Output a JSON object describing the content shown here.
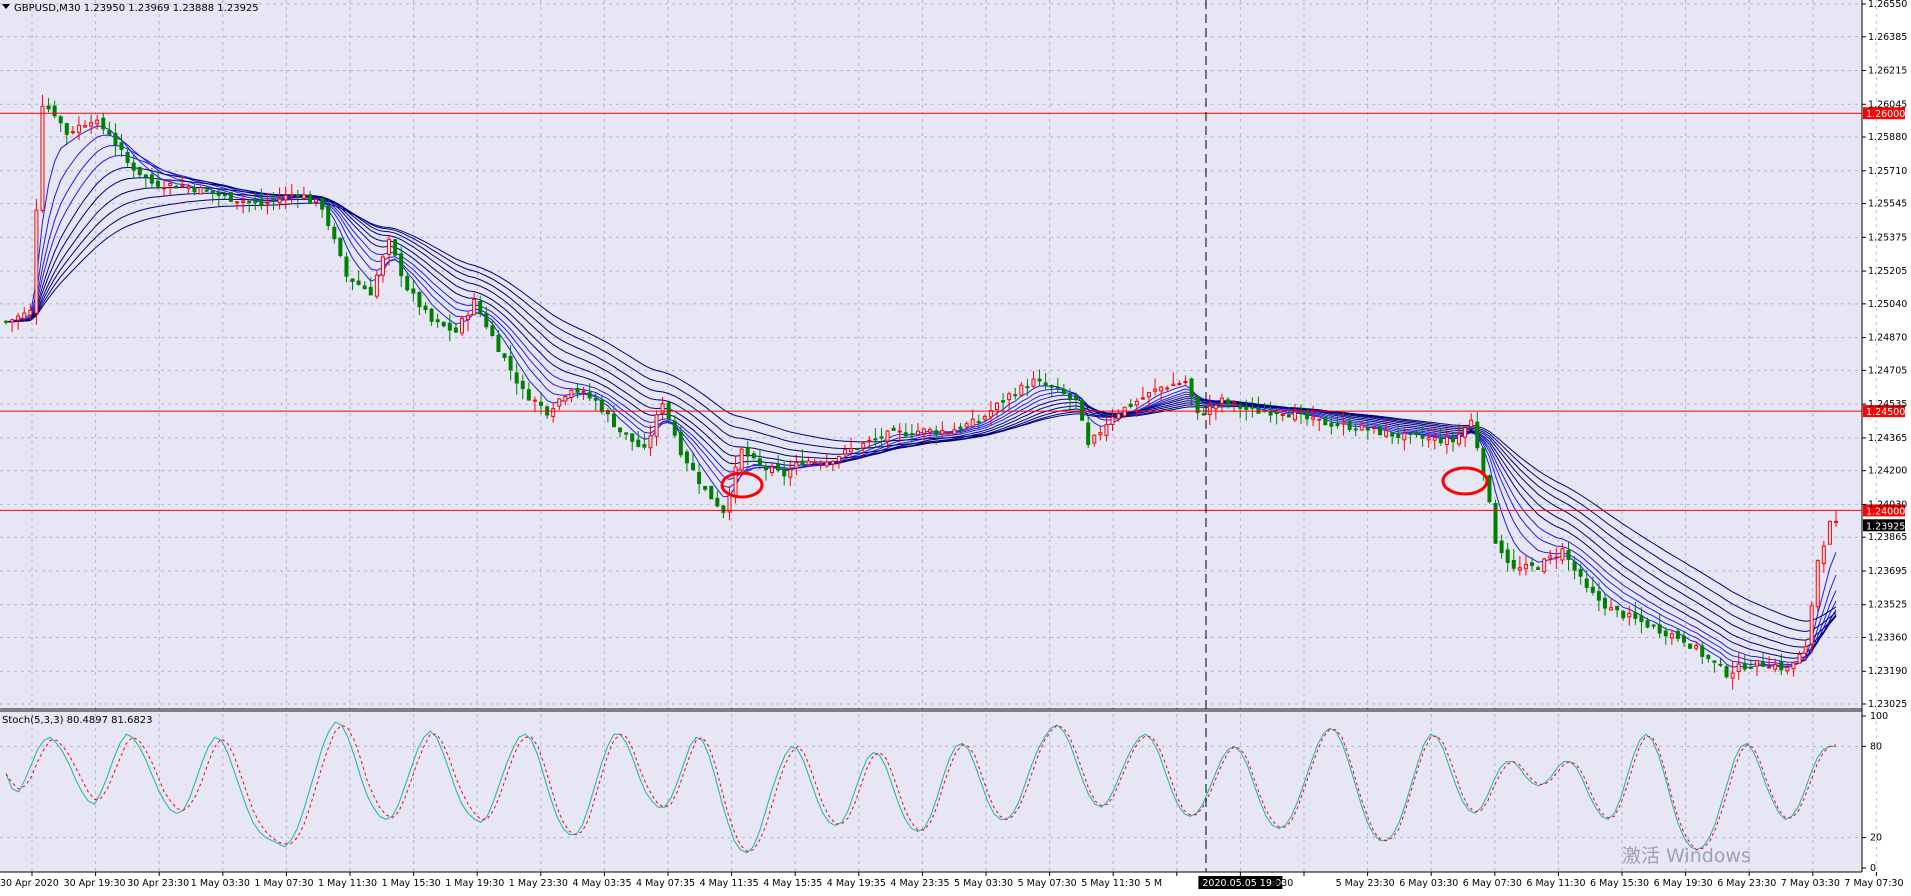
{
  "window": {
    "symbol_header": "GBPUSD,M30  1.23950 1.23969 1.23888 1.23925",
    "stoch_header": "Stoch(5,3,3) 80.4897 81.6823",
    "watermark": "激活 Windows"
  },
  "colors": {
    "background": "#e6e6f5",
    "grid": "#9a9ab4",
    "bull_candle": "#ff0000",
    "bear_candle": "#008000",
    "ma_ribbon": "#000080",
    "horizontal_lines": "#ff0000",
    "stoch_main": "#20b2aa",
    "stoch_signal": "#ff0000"
  },
  "chart_data": [
    {
      "type": "candlestick",
      "title": "GBPUSD,M30",
      "ylim": [
        1.23025,
        1.2655
      ],
      "y_ticks": [
        "1.26550",
        "1.26385",
        "1.26215",
        "1.26045",
        "1.25880",
        "1.25710",
        "1.25545",
        "1.25375",
        "1.25205",
        "1.25040",
        "1.24870",
        "1.24705",
        "1.24535",
        "1.24365",
        "1.24200",
        "1.24030",
        "1.23865",
        "1.23695",
        "1.23525",
        "1.23360",
        "1.23190",
        "1.23025"
      ],
      "x_ticks": [
        "30 Apr 2020",
        "30 Apr 19:30",
        "30 Apr 23:30",
        "1 May 03:30",
        "1 May 07:30",
        "1 May 11:30",
        "1 May 15:30",
        "1 May 19:30",
        "1 May 23:30",
        "4 May 03:35",
        "4 May 07:35",
        "4 May 11:35",
        "4 May 15:35",
        "4 May 19:35",
        "4 May 23:35",
        "5 May 03:30",
        "5 May 07:30",
        "5 May 11:30",
        "5 M",
        "2020.05.05 19:00",
        "9:30",
        "5 May 23:30",
        "6 May 03:30",
        "6 May 07:30",
        "6 May 11:30",
        "6 May 15:30",
        "6 May 19:30",
        "6 May 23:30",
        "7 May 03:30",
        "7 May 07:30"
      ],
      "price_levels": [
        {
          "label": "1.26000",
          "value": 1.26
        },
        {
          "label": "1.24500",
          "value": 1.245
        },
        {
          "label": "1.24000",
          "value": 1.24
        }
      ],
      "current_price": {
        "label": "1.23925",
        "value": 1.23925
      },
      "path_anchors": [
        [
          0,
          1.2495
        ],
        [
          4,
          1.25
        ],
        [
          6,
          1.2605
        ],
        [
          8,
          1.26
        ],
        [
          10,
          1.259
        ],
        [
          14,
          1.2597
        ],
        [
          17,
          1.259
        ],
        [
          20,
          1.2575
        ],
        [
          24,
          1.2565
        ],
        [
          30,
          1.2563
        ],
        [
          36,
          1.2558
        ],
        [
          42,
          1.2554
        ],
        [
          48,
          1.256
        ],
        [
          52,
          1.2553
        ],
        [
          56,
          1.2518
        ],
        [
          60,
          1.251
        ],
        [
          63,
          1.2535
        ],
        [
          66,
          1.2512
        ],
        [
          70,
          1.2495
        ],
        [
          74,
          1.249
        ],
        [
          77,
          1.2505
        ],
        [
          81,
          1.2482
        ],
        [
          85,
          1.246
        ],
        [
          89,
          1.245
        ],
        [
          93,
          1.2462
        ],
        [
          97,
          1.2455
        ],
        [
          101,
          1.244
        ],
        [
          105,
          1.243
        ],
        [
          108,
          1.2455
        ],
        [
          111,
          1.243
        ],
        [
          115,
          1.241
        ],
        [
          118,
          1.24
        ],
        [
          121,
          1.243
        ],
        [
          124,
          1.2422
        ],
        [
          128,
          1.2418
        ],
        [
          131,
          1.2425
        ],
        [
          135,
          1.2425
        ],
        [
          140,
          1.2432
        ],
        [
          145,
          1.2438
        ],
        [
          150,
          1.244
        ],
        [
          155,
          1.244
        ],
        [
          160,
          1.2445
        ],
        [
          165,
          1.2458
        ],
        [
          169,
          1.2465
        ],
        [
          173,
          1.246
        ],
        [
          176,
          1.2455
        ],
        [
          178,
          1.2432
        ],
        [
          182,
          1.2448
        ],
        [
          186,
          1.2455
        ],
        [
          190,
          1.2462
        ],
        [
          194,
          1.2465
        ],
        [
          196,
          1.2448
        ],
        [
          200,
          1.2455
        ],
        [
          205,
          1.245
        ],
        [
          210,
          1.245
        ],
        [
          215,
          1.2445
        ],
        [
          222,
          1.2442
        ],
        [
          230,
          1.2437
        ],
        [
          238,
          1.2435
        ],
        [
          241,
          1.2445
        ],
        [
          243,
          1.242
        ],
        [
          245,
          1.2385
        ],
        [
          248,
          1.237
        ],
        [
          252,
          1.2372
        ],
        [
          256,
          1.238
        ],
        [
          260,
          1.236
        ],
        [
          264,
          1.235
        ],
        [
          268,
          1.2345
        ],
        [
          272,
          1.234
        ],
        [
          276,
          1.2335
        ],
        [
          280,
          1.2325
        ],
        [
          283,
          1.2318
        ],
        [
          286,
          1.2322
        ],
        [
          290,
          1.2323
        ],
        [
          293,
          1.232
        ],
        [
          296,
          1.233
        ],
        [
          298,
          1.2375
        ],
        [
          300,
          1.2393
        ],
        [
          301,
          1.23925
        ]
      ],
      "stochastic": {
        "type": "line",
        "ylim": [
          0,
          100
        ],
        "y_ticks": [
          "100",
          "80",
          "20",
          "0"
        ],
        "levels": [
          80,
          20
        ],
        "series": [
          {
            "name": "main",
            "values": [
              62,
              52,
              50,
              58,
              68,
              78,
              84,
              86,
              82,
              76,
              68,
              58,
              50,
              44,
              42,
              50,
              60,
              72,
              82,
              88,
              86,
              80,
              72,
              62,
              52,
              44,
              38,
              36,
              38,
              46,
              58,
              70,
              80,
              86,
              84,
              76,
              64,
              52,
              40,
              30,
              24,
              20,
              18,
              16,
              14,
              18,
              26,
              38,
              52,
              66,
              80,
              90,
              96,
              94,
              86,
              74,
              60,
              48,
              40,
              34,
              32,
              34,
              42,
              54,
              66,
              78,
              86,
              90,
              86,
              76,
              64,
              52,
              42,
              36,
              32,
              30,
              34,
              44,
              56,
              68,
              78,
              86,
              88,
              84,
              74,
              60,
              46,
              34,
              26,
              22,
              22,
              28,
              40,
              54,
              68,
              80,
              88,
              88,
              82,
              72,
              60,
              50,
              44,
              40,
              40,
              46,
              56,
              68,
              80,
              86,
              84,
              74,
              60,
              44,
              30,
              18,
              12,
              10,
              14,
              24,
              38,
              52,
              64,
              74,
              80,
              78,
              70,
              58,
              46,
              36,
              30,
              28,
              30,
              38,
              50,
              62,
              72,
              76,
              74,
              66,
              54,
              42,
              32,
              26,
              24,
              26,
              34,
              46,
              60,
              72,
              80,
              82,
              78,
              68,
              56,
              44,
              36,
              32,
              32,
              36,
              44,
              56,
              68,
              78,
              86,
              92,
              94,
              90,
              82,
              70,
              58,
              48,
              42,
              40,
              44,
              52,
              62,
              72,
              80,
              86,
              88,
              84,
              76,
              64,
              52,
              42,
              36,
              34,
              36,
              42,
              52,
              62,
              72,
              78,
              80,
              76,
              68,
              56,
              44,
              34,
              28,
              26,
              28,
              34,
              44,
              56,
              68,
              80,
              88,
              92,
              90,
              82,
              70,
              56,
              42,
              30,
              22,
              18,
              18,
              22,
              30,
              42,
              56,
              70,
              82,
              88,
              86,
              78,
              66,
              54,
              44,
              38,
              36,
              40,
              48,
              58,
              66,
              70,
              70,
              66,
              60,
              56,
              54,
              56,
              60,
              66,
              70,
              70,
              66,
              58,
              48,
              40,
              34,
              32,
              36,
              46,
              60,
              74,
              84,
              88,
              84,
              74,
              60,
              44,
              30,
              20,
              14,
              12,
              14,
              20,
              30,
              44,
              58,
              72,
              80,
              82,
              76,
              66,
              54,
              44,
              36,
              32,
              34,
              40,
              50,
              62,
              72,
              78,
              80,
              80
            ]
          },
          {
            "name": "signal",
            "values": [
              62,
              56,
              52,
              54,
              60,
              70,
              78,
              84,
              84,
              80,
              74,
              66,
              58,
              50,
              45,
              46,
              52,
              62,
              72,
              82,
              86,
              84,
              78,
              70,
              60,
              50,
              44,
              39,
              38,
              41,
              48,
              58,
              70,
              80,
              85,
              82,
              74,
              62,
              50,
              38,
              30,
              24,
              20,
              17,
              16,
              16,
              20,
              28,
              40,
              54,
              68,
              80,
              90,
              94,
              92,
              84,
              72,
              58,
              48,
              40,
              35,
              33,
              37,
              46,
              58,
              70,
              80,
              88,
              88,
              82,
              72,
              60,
              50,
              42,
              36,
              32,
              32,
              38,
              48,
              60,
              72,
              82,
              86,
              86,
              80,
              68,
              54,
              40,
              30,
              24,
              22,
              24,
              32,
              46,
              60,
              74,
              84,
              88,
              86,
              78,
              66,
              56,
              48,
              42,
              40,
              42,
              50,
              62,
              74,
              84,
              86,
              80,
              68,
              52,
              36,
              24,
              15,
              11,
              12,
              18,
              28,
              42,
              56,
              68,
              76,
              80,
              76,
              66,
              54,
              42,
              34,
              29,
              29,
              33,
              42,
              54,
              66,
              74,
              76,
              72,
              62,
              50,
              38,
              30,
              25,
              25,
              30,
              40,
              54,
              66,
              76,
              81,
              80,
              74,
              62,
              50,
              40,
              34,
              32,
              34,
              40,
              50,
              62,
              74,
              84,
              90,
              94,
              92,
              86,
              76,
              64,
              52,
              44,
              41,
              42,
              48,
              58,
              68,
              77,
              84,
              87,
              86,
              80,
              70,
              58,
              46,
              38,
              35,
              35,
              40,
              48,
              58,
              68,
              76,
              80,
              78,
              72,
              60,
              48,
              38,
              31,
              27,
              27,
              31,
              40,
              52,
              64,
              76,
              86,
              91,
              91,
              86,
              74,
              60,
              46,
              34,
              24,
              19,
              18,
              20,
              26,
              38,
              52,
              66,
              78,
              86,
              87,
              82,
              72,
              60,
              48,
              40,
              37,
              38,
              44,
              54,
              62,
              68,
              70,
              68,
              63,
              58,
              55,
              55,
              58,
              63,
              68,
              70,
              68,
              62,
              52,
              43,
              36,
              33,
              34,
              42,
              54,
              68,
              80,
              87,
              86,
              78,
              64,
              48,
              34,
              23,
              16,
              12,
              13,
              17,
              26,
              38,
              52,
              66,
              77,
              81,
              79,
              70,
              58,
              47,
              38,
              33,
              33,
              37,
              46,
              57,
              68,
              76,
              80,
              81
            ]
          }
        ]
      }
    }
  ]
}
